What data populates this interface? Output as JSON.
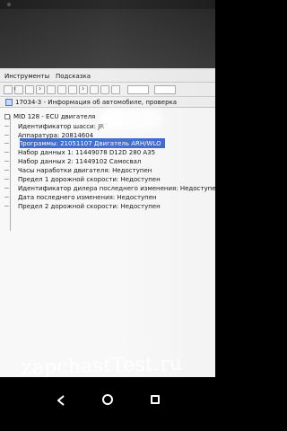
{
  "menu": {
    "tools_label": "Инструменты",
    "help_label": "Подсказка"
  },
  "document_tab": {
    "title": "17034-3 - Информация об автомобиле, проверка"
  },
  "tree": {
    "root_label": "MID 128 - ECU двигателя",
    "children": [
      {
        "label": "Идентификатор шасси: JR"
      },
      {
        "label": "Аппаратура: 20814604"
      },
      {
        "label": "Программы: 21051107 Двигатель ARH/WLO",
        "selected": true
      },
      {
        "label": "Набор данных 1: 11449078 D12D 280 A35"
      },
      {
        "label": "Набор данных 2: 11449102 Самосвал"
      },
      {
        "label": "Часы наработки двигателя: Недоступен"
      },
      {
        "label": "Предел 1 дорожной скорости: Недоступен"
      },
      {
        "label": "Идентификатор дилера последнего изменения: Недоступен"
      },
      {
        "label": "Дата последнего изменения: Недоступен"
      },
      {
        "label": "Предел 2 дорожной скорости: Недоступен"
      }
    ]
  },
  "watermark": {
    "text": "zapchastTest.ru"
  },
  "colors": {
    "selection": "#3c69cf",
    "window_bg": "#f8f8f8",
    "toolbar_bg": "#efefef"
  }
}
